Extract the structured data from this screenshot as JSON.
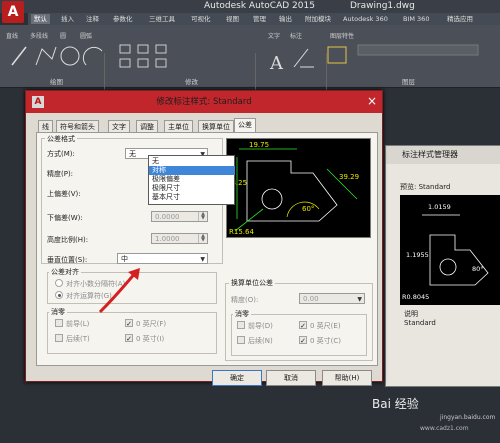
{
  "app": {
    "title": "Autodesk AutoCAD 2015",
    "drawing": "Drawing1.dwg",
    "logo": "A",
    "tabs": [
      "默认",
      "插入",
      "注释",
      "参数化",
      "三维工具",
      "可视化",
      "视图",
      "管理",
      "输出",
      "附加模块",
      "Autodesk 360",
      "BIM 360",
      "精选应用"
    ],
    "ribbon_groups": [
      "绘图",
      "修改",
      "图层"
    ],
    "ribbon_tools": [
      "直线",
      "多段线",
      "圆",
      "圆弧",
      "文字",
      "标注",
      "图层特性"
    ],
    "accent": "#c1262c"
  },
  "dialog": {
    "title": "修改标注样式: Standard",
    "icon": "A",
    "close": "×",
    "tabs": [
      "线",
      "符号和箭头",
      "文字",
      "调整",
      "主单位",
      "换算单位",
      "公差"
    ],
    "active_tab": "公差",
    "tolerance_format": {
      "group_title": "公差格式",
      "method_label": "方式(M):",
      "method_value": "无",
      "method_options": [
        "无",
        "对称",
        "极限偏差",
        "极限尺寸",
        "基本尺寸"
      ],
      "highlighted_option": "对称",
      "precision_label": "精度(P):",
      "upper_label": "上偏差(V):",
      "lower_label": "下偏差(W):",
      "lower_value": "0.0000",
      "height_label": "高度比例(H):",
      "height_value": "1.0000",
      "vpos_label": "垂直位置(S):",
      "vpos_value": "中"
    },
    "tolerance_align": {
      "group_title": "公差对齐",
      "opt1": "对齐小数分隔符(A)",
      "opt2": "对齐运算符(G)"
    },
    "zero_suppression": {
      "group_title": "消零",
      "leading": "前导(L)",
      "trailing": "后续(T)",
      "feet": "0 英尺(F)",
      "inches": "0 英寸(I)"
    },
    "alt_tolerance": {
      "group_title": "换算单位公差",
      "precision_label": "精度(O):",
      "precision_value": "0.00",
      "zero_title": "消零",
      "leading": "前导(D)",
      "trailing": "后续(N)",
      "feet": "0 英尺(E)",
      "inches": "0 英寸(C)"
    },
    "preview": {
      "dims": [
        "19.75",
        "23.25",
        "39.29",
        "60°",
        "R15.64"
      ]
    },
    "buttons": {
      "ok": "确定",
      "cancel": "取消",
      "help": "帮助(H)"
    }
  },
  "bg_dialog": {
    "title": "标注样式管理器",
    "preview_label": "预览: Standard",
    "dims": [
      "1.0159",
      "1.1955",
      "80°",
      "R0.8045"
    ],
    "desc_label": "说明",
    "desc_value": "Standard"
  },
  "watermark": {
    "text": "Bai 经验",
    "url": "jingyan.baidu.com",
    "url2": "www.cadz1.com"
  }
}
